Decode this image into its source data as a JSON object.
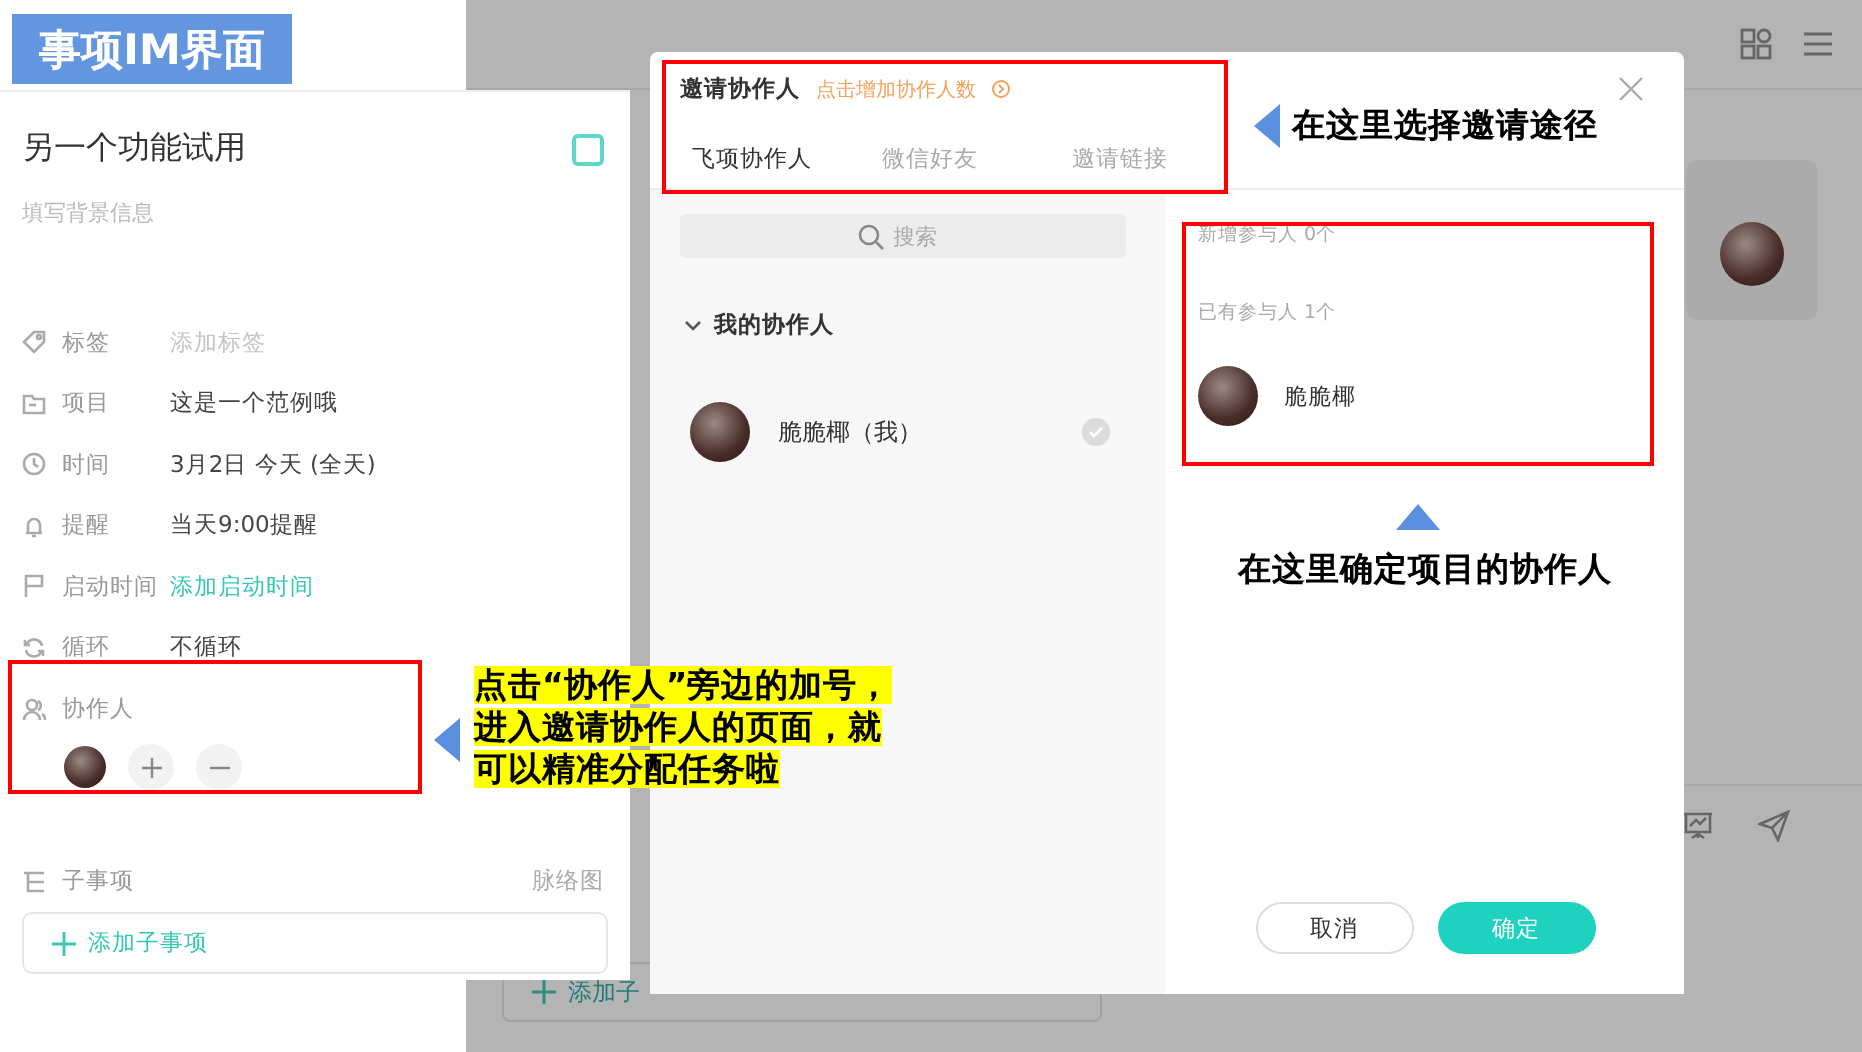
{
  "title_badge": "事项IM界面",
  "task_panel": {
    "title": "另一个功能试用",
    "completed": false,
    "background_placeholder": "填写背景信息",
    "fields": [
      {
        "label": "标签",
        "placeholder": "添加标签",
        "kind": "empty"
      },
      {
        "label": "项目",
        "value": "这是一个范例哦",
        "kind": "plain"
      },
      {
        "label": "时间",
        "value": "3月2日 今天 (全天)",
        "kind": "plain"
      },
      {
        "label": "提醒",
        "value": "当天9:00提醒",
        "kind": "plain"
      },
      {
        "label": "启动时间",
        "value": "添加启动时间",
        "kind": "link"
      },
      {
        "label": "循环",
        "value": "不循环",
        "kind": "plain"
      }
    ],
    "collaborators": {
      "label": "协作人"
    },
    "subtasks": {
      "label": "子事项",
      "mindmap": "脉络图",
      "add_button": "添加子事项"
    }
  },
  "background": {
    "add_button": "添加子"
  },
  "invite_dialog": {
    "title": "邀请协作人",
    "hint": "点击增加协作人数",
    "tabs": [
      {
        "label": "飞项协作人",
        "selected": true
      },
      {
        "label": "微信好友",
        "selected": false
      },
      {
        "label": "邀请链接",
        "selected": false
      }
    ],
    "search": {
      "placeholder": "搜索"
    },
    "group": {
      "label": "我的协作人",
      "expanded": true,
      "members": [
        {
          "name": "脆脆椰（我）",
          "checked": true
        }
      ]
    },
    "new_participants": "新增参与人 0个",
    "existing_participants": "已有参与人 1个",
    "participants": [
      {
        "name": "脆脆椰"
      }
    ],
    "cancel": "取消",
    "confirm": "确定"
  },
  "annotations": {
    "invite_path": "在这里选择邀请途径",
    "confirm_collaborators": "在这里确定项目的协作人",
    "collaborator_hint": [
      "点击“协作人”旁边的加号，",
      "进入邀请协作人的页面，就",
      "可以精准分配任务啦"
    ]
  }
}
